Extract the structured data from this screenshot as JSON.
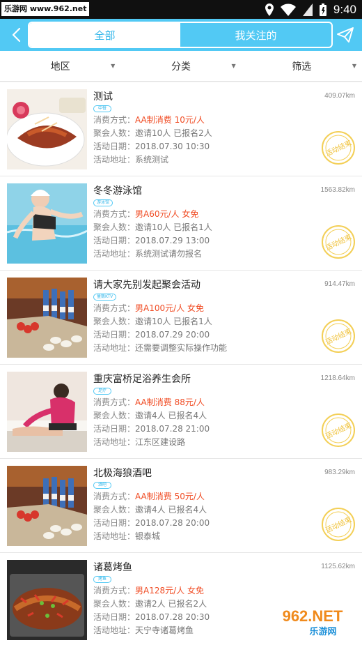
{
  "statusbar": {
    "watermark": "乐游网 www.962.net",
    "time": "9:40"
  },
  "header": {
    "tabs": [
      "全部",
      "我关注的"
    ]
  },
  "filters": [
    "地区",
    "分类",
    "筛选"
  ],
  "labels": {
    "cost": "消费方式：",
    "people": "聚会人数：",
    "date": "活动日期：",
    "addr": "活动地址："
  },
  "stamp_text": "活动结束",
  "items": [
    {
      "title": "测试",
      "distance": "409.07km",
      "tag": "中餐",
      "cost": "AA制消费 10元/人",
      "people": "邀请10人 已报名2人",
      "date": "2018.07.30 10:30",
      "address": "系统测试"
    },
    {
      "title": "冬冬游泳馆",
      "distance": "1563.82km",
      "tag": "游泳馆",
      "cost": "男A60元/人 女免",
      "people": "邀请10人 已报名1人",
      "date": "2018.07.29 13:00",
      "address": "系统测试请勿报名"
    },
    {
      "title": "请大家先别发起聚会活动",
      "distance": "914.47km",
      "tag": "量贩KTV",
      "cost": "男A100元/人 女免",
      "people": "邀请10人 已报名1人",
      "date": "2018.07.29 20:00",
      "address": "还需要调整实际操作功能"
    },
    {
      "title": "重庆富桥足浴养生会所",
      "distance": "1218.64km",
      "tag": "足疗",
      "cost": "AA制消费 88元/人",
      "people": "邀请4人 已报名4人",
      "date": "2018.07.28 21:00",
      "address": "江东区建设路"
    },
    {
      "title": "北极海狼酒吧",
      "distance": "983.29km",
      "tag": "酒吧",
      "cost": "AA制消费 50元/人",
      "people": "邀请4人 已报名4人",
      "date": "2018.07.28 20:00",
      "address": "银泰城"
    },
    {
      "title": "诸葛烤鱼",
      "distance": "1125.62km",
      "tag": "烤鱼",
      "cost": "男A128元/人 女免",
      "people": "邀请2人 已报名2人",
      "date": "2018.07.28 20:30",
      "address": "天宁寺诸葛烤鱼"
    }
  ],
  "footer_watermark": {
    "brand": "962.NET",
    "sub": "乐游网"
  }
}
